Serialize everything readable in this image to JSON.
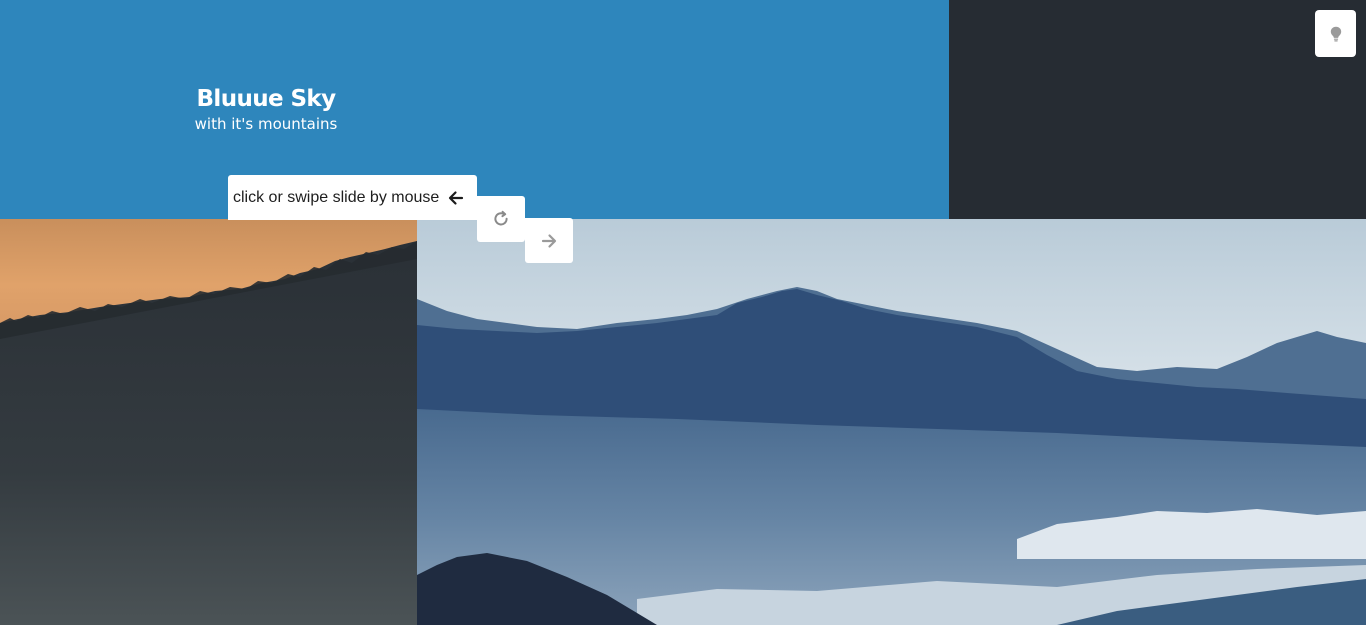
{
  "slide": {
    "title": "Bluuue Sky",
    "subtitle": "with it's mountains"
  },
  "controls": {
    "hint": "click or swipe slide by mouse",
    "prev_icon": "arrow-left-icon",
    "reload_icon": "reload-icon",
    "next_icon": "arrow-right-icon",
    "theme_icon": "lightbulb-icon"
  },
  "colors": {
    "hero_blue": "#2e86bc",
    "dark_panel": "#262c33",
    "button_bg": "#ffffff"
  }
}
